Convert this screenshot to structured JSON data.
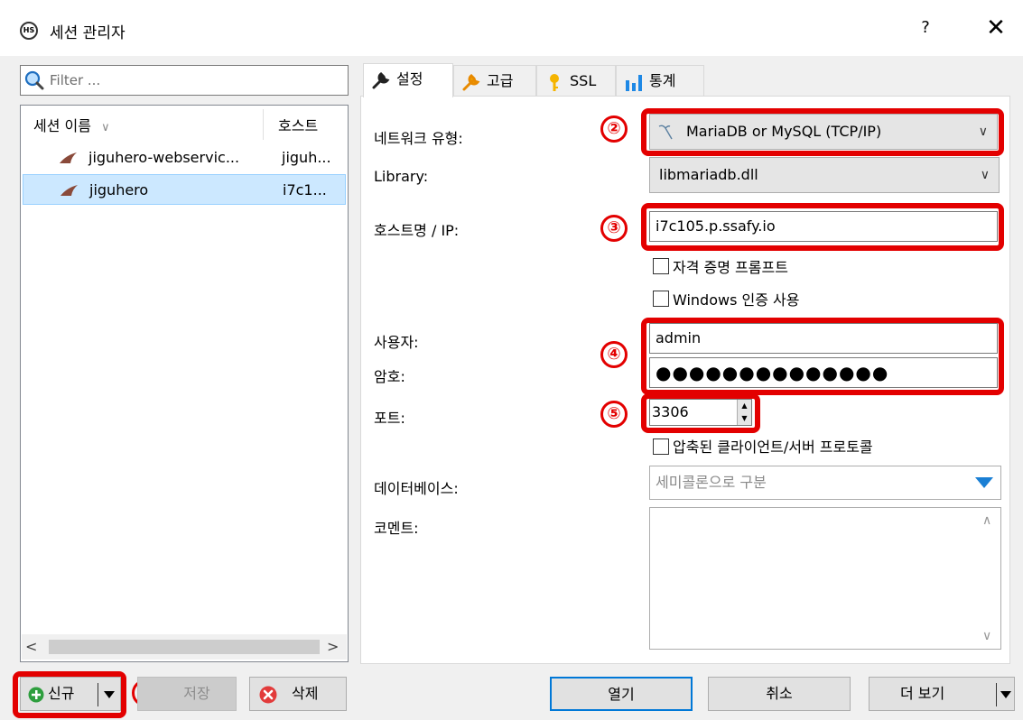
{
  "window": {
    "app_icon_text": "HS",
    "title": "세션 관리자",
    "help": "?",
    "close": "✕"
  },
  "filter": {
    "placeholder": "Filter ..."
  },
  "session_list": {
    "columns": [
      "세션 이름",
      "호스트"
    ],
    "sort_indicator": "∨",
    "rows": [
      {
        "name": "jiguhero-webservic...",
        "host": "jiguh...",
        "selected": false
      },
      {
        "name": "jiguhero",
        "host": "i7c1...",
        "selected": true
      }
    ],
    "scroll_left": "<",
    "scroll_right": ">"
  },
  "tabs": [
    {
      "label": "설정",
      "icon": "wrench-icon",
      "active": true
    },
    {
      "label": "고급",
      "icon": "wrench-orange-icon",
      "active": false
    },
    {
      "label": "SSL",
      "icon": "key-icon",
      "active": false
    },
    {
      "label": "통계",
      "icon": "bar-chart-icon",
      "active": false
    }
  ],
  "settings": {
    "network_type_label": "네트워크 유형:",
    "network_type_value": "MariaDB or MySQL (TCP/IP)",
    "library_label": "Library:",
    "library_value": "libmariadb.dll",
    "host_label": "호스트명 / IP:",
    "host_value": "i7c105.p.ssafy.io",
    "credential_prompt_label": "자격 증명 프롬프트",
    "windows_auth_label": "Windows 인증 사용",
    "user_label": "사용자:",
    "user_value": "admin",
    "password_label": "암호:",
    "password_value": "●●●●●●●●●●●●●●",
    "port_label": "포트:",
    "port_value": "3306",
    "compression_label": "압축된 클라이언트/서버 프로토콜",
    "database_label": "데이터베이스:",
    "database_placeholder": "세미콜론으로 구분",
    "comment_label": "코멘트:"
  },
  "markers": [
    "①",
    "②",
    "③",
    "④",
    "⑤"
  ],
  "buttons": {
    "new": "신규",
    "save": "저장",
    "delete": "삭제",
    "open": "열기",
    "cancel": "취소",
    "more": "더 보기"
  },
  "colors": {
    "highlight_red": "#e30000",
    "selection_blue": "#cce8ff",
    "default_button_border": "#0078d7"
  }
}
